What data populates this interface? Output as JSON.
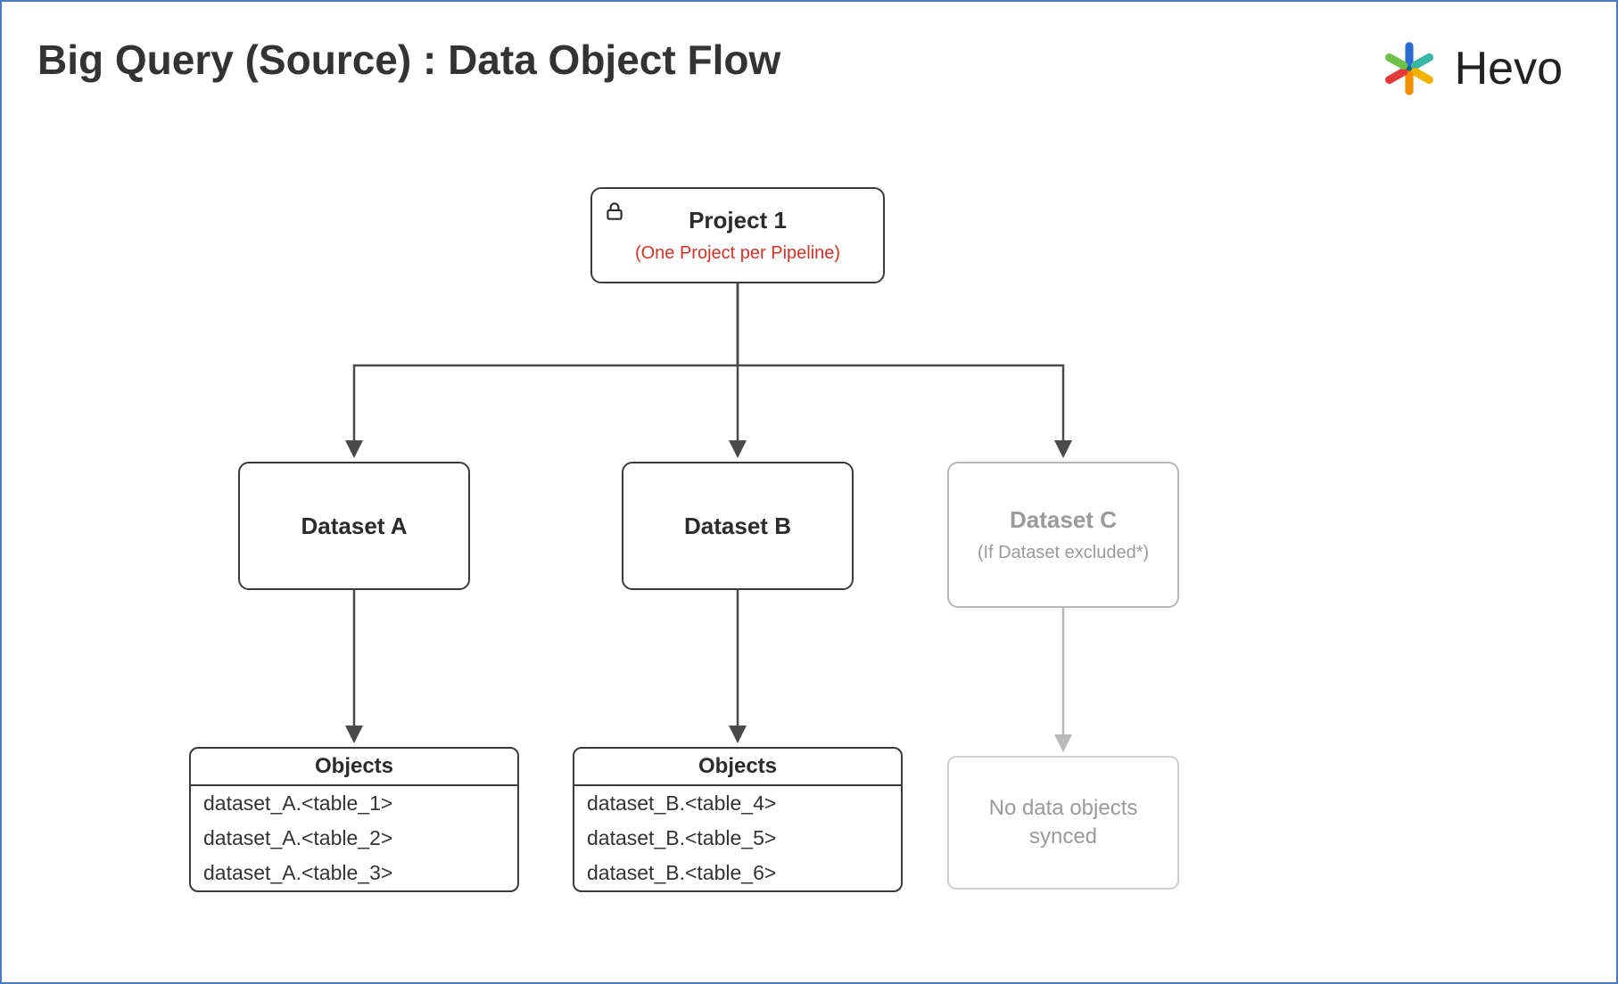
{
  "title": "Big Query (Source) : Data Object Flow",
  "brand": {
    "name": "Hevo"
  },
  "project": {
    "label": "Project 1",
    "note": "(One Project per Pipeline)"
  },
  "datasets": [
    {
      "label": "Dataset A",
      "note": "",
      "muted": false,
      "objects_header": "Objects",
      "objects": [
        "dataset_A.<table_1>",
        "dataset_A.<table_2>",
        "dataset_A.<table_3>"
      ]
    },
    {
      "label": "Dataset B",
      "note": "",
      "muted": false,
      "objects_header": "Objects",
      "objects": [
        "dataset_B.<table_4>",
        "dataset_B.<table_5>",
        "dataset_B.<table_6>"
      ]
    },
    {
      "label": "Dataset C",
      "note": "(If Dataset excluded*)",
      "muted": true,
      "no_sync_text": "No data objects synced"
    }
  ],
  "colors": {
    "accent_red": "#d93025",
    "muted_gray": "#9a9a9a",
    "border_dark": "#3a3a3a",
    "border_muted": "#b9b9b9",
    "frame_border": "#4a7cc4"
  }
}
